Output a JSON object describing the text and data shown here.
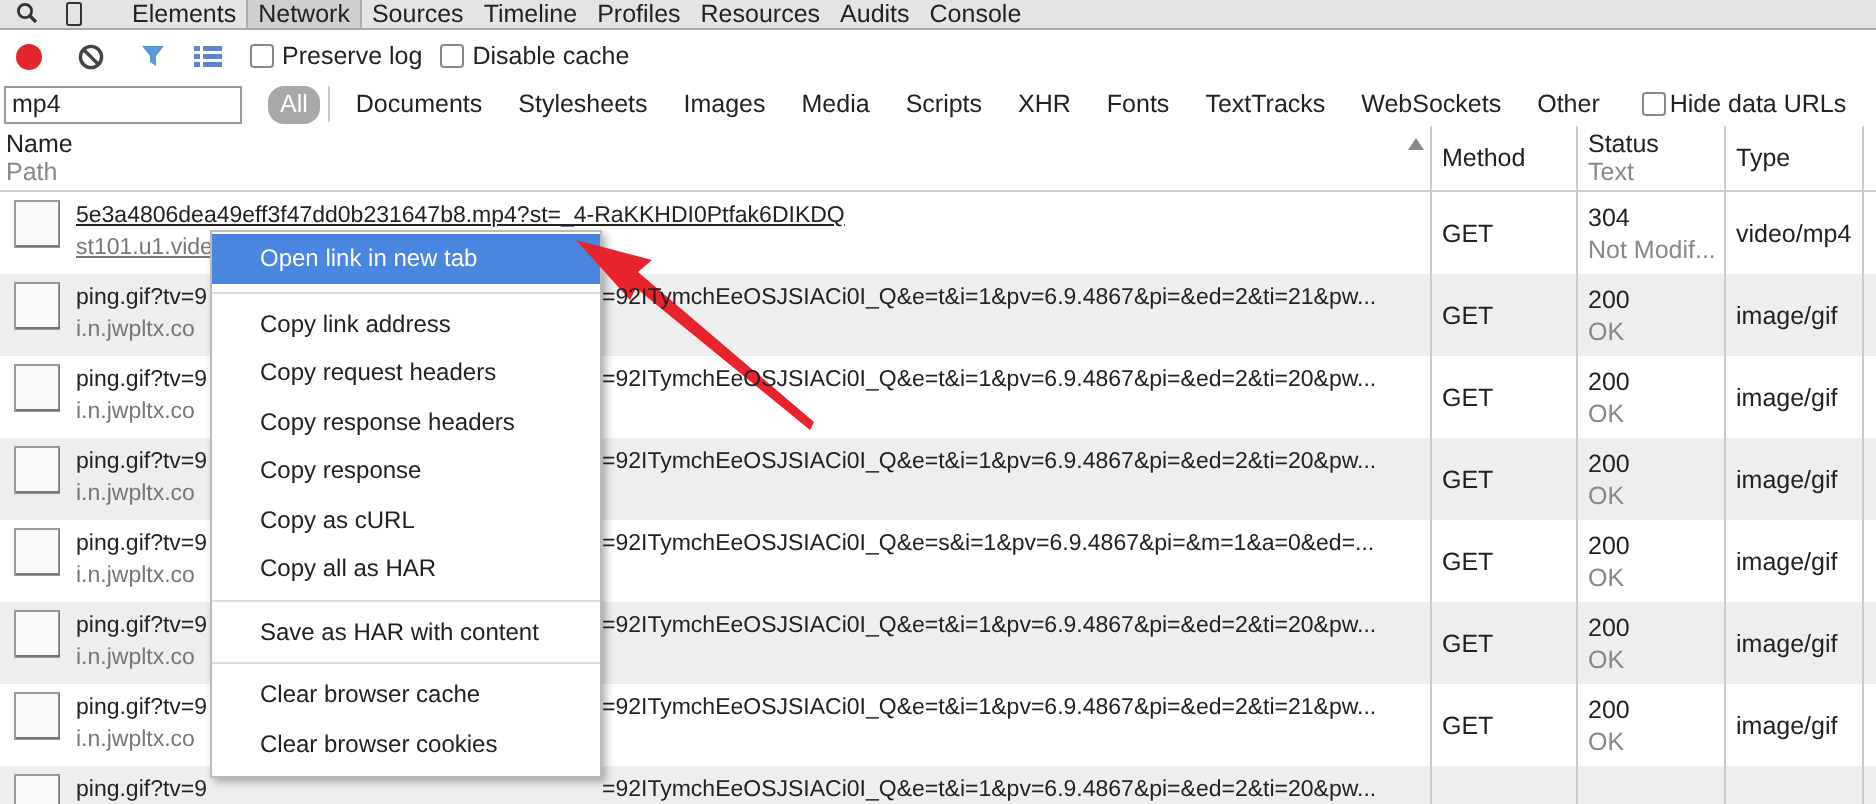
{
  "panel_tabs": [
    {
      "label": "Elements",
      "selected": false
    },
    {
      "label": "Network",
      "selected": true
    },
    {
      "label": "Sources",
      "selected": false
    },
    {
      "label": "Timeline",
      "selected": false
    },
    {
      "label": "Profiles",
      "selected": false
    },
    {
      "label": "Resources",
      "selected": false
    },
    {
      "label": "Audits",
      "selected": false
    },
    {
      "label": "Console",
      "selected": false
    }
  ],
  "toolbar": {
    "recording": true,
    "filter_on": true,
    "checkboxes": [
      {
        "label": "Preserve log",
        "checked": false
      },
      {
        "label": "Disable cache",
        "checked": false
      }
    ]
  },
  "filter": {
    "value": "mp4",
    "types": [
      {
        "label": "All",
        "selected": true
      },
      {
        "label": "Documents",
        "selected": false
      },
      {
        "label": "Stylesheets",
        "selected": false
      },
      {
        "label": "Images",
        "selected": false
      },
      {
        "label": "Media",
        "selected": false
      },
      {
        "label": "Scripts",
        "selected": false
      },
      {
        "label": "XHR",
        "selected": false
      },
      {
        "label": "Fonts",
        "selected": false
      },
      {
        "label": "TextTracks",
        "selected": false
      },
      {
        "label": "WebSockets",
        "selected": false
      },
      {
        "label": "Other",
        "selected": false
      }
    ],
    "hide_data_urls": {
      "label": "Hide data URLs",
      "checked": false
    }
  },
  "columns": {
    "name": "Name",
    "path": "Path",
    "method": "Method",
    "status": "Status",
    "status_text": "Text",
    "type": "Type"
  },
  "rows": [
    {
      "name": "5e3a4806dea49eff3f47dd0b231647b8.mp4?st=_4-RaKKHDI0Ptfak6DIKDQ",
      "link": true,
      "path": "st101.u1.vide",
      "method": "GET",
      "status": "304",
      "status_text": "Not Modif...",
      "type": "video/mp4"
    },
    {
      "name": "ping.gif?tv=9",
      "name_tail": "=92ITymchEeOSJSIACi0I_Q&e=t&i=1&pv=6.9.4867&pi=&ed=2&ti=21&pw...",
      "link": false,
      "path": "i.n.jwpltx.co",
      "method": "GET",
      "status": "200",
      "status_text": "OK",
      "type": "image/gif"
    },
    {
      "name": "ping.gif?tv=9",
      "name_tail": "=92ITymchEeOSJSIACi0I_Q&e=t&i=1&pv=6.9.4867&pi=&ed=2&ti=20&pw...",
      "link": false,
      "path": "i.n.jwpltx.co",
      "method": "GET",
      "status": "200",
      "status_text": "OK",
      "type": "image/gif"
    },
    {
      "name": "ping.gif?tv=9",
      "name_tail": "=92ITymchEeOSJSIACi0I_Q&e=t&i=1&pv=6.9.4867&pi=&ed=2&ti=20&pw...",
      "link": false,
      "path": "i.n.jwpltx.co",
      "method": "GET",
      "status": "200",
      "status_text": "OK",
      "type": "image/gif"
    },
    {
      "name": "ping.gif?tv=9",
      "name_tail": "=92ITymchEeOSJSIACi0I_Q&e=s&i=1&pv=6.9.4867&pi=&m=1&a=0&ed=...",
      "link": false,
      "path": "i.n.jwpltx.co",
      "method": "GET",
      "status": "200",
      "status_text": "OK",
      "type": "image/gif"
    },
    {
      "name": "ping.gif?tv=9",
      "name_tail": "=92ITymchEeOSJSIACi0I_Q&e=t&i=1&pv=6.9.4867&pi=&ed=2&ti=20&pw...",
      "link": false,
      "path": "i.n.jwpltx.co",
      "method": "GET",
      "status": "200",
      "status_text": "OK",
      "type": "image/gif"
    },
    {
      "name": "ping.gif?tv=9",
      "name_tail": "=92ITymchEeOSJSIACi0I_Q&e=t&i=1&pv=6.9.4867&pi=&ed=2&ti=21&pw...",
      "link": false,
      "path": "i.n.jwpltx.co",
      "method": "GET",
      "status": "200",
      "status_text": "OK",
      "type": "image/gif"
    },
    {
      "name": "ping.gif?tv=9",
      "name_tail": "=92ITymchEeOSJSIACi0I_Q&e=t&i=1&pv=6.9.4867&pi=&ed=2&ti=20&pw...",
      "link": false
    }
  ],
  "context_menu": [
    [
      {
        "label": "Open link in new tab",
        "selected": true
      }
    ],
    [
      {
        "label": "Copy link address",
        "selected": false
      },
      {
        "label": "Copy request headers",
        "selected": false
      },
      {
        "label": "Copy response headers",
        "selected": false
      },
      {
        "label": "Copy response",
        "selected": false
      },
      {
        "label": "Copy as cURL",
        "selected": false
      },
      {
        "label": "Copy all as HAR",
        "selected": false
      }
    ],
    [
      {
        "label": "Save as HAR with content",
        "selected": false
      }
    ],
    [
      {
        "label": "Clear browser cache",
        "selected": false
      },
      {
        "label": "Clear browser cookies",
        "selected": false
      }
    ]
  ]
}
